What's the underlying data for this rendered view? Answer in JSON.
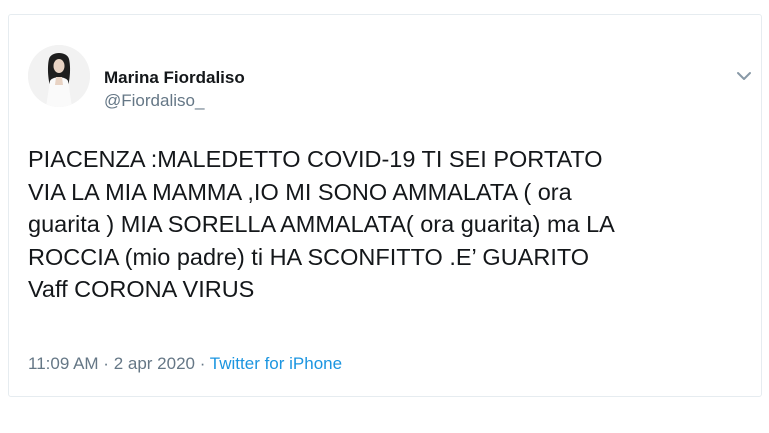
{
  "tweet": {
    "author_name": "Marina Fiordaliso",
    "author_handle": "@Fiordaliso_",
    "avatar_icon": "profile-photo",
    "menu_icon": "chevron-down-icon",
    "text_lines": [
      "PIACENZA :MALEDETTO COVID-19 TI SEI PORTATO",
      "VIA LA MIA MAMMA ,IO MI SONO AMMALATA ( ora",
      "guarita ) MIA SORELLA AMMALATA( ora guarita) ma LA",
      "ROCCIA (mio padre) ti HA SCONFITTO .E’ GUARITO",
      "Vaff CORONA VIRUS"
    ],
    "time": "11:09 AM",
    "separator": " · ",
    "date": "2 apr 2020",
    "source": "Twitter for iPhone"
  },
  "colors": {
    "text_primary": "#14171a",
    "text_secondary": "#657786",
    "link": "#1b95e0",
    "border": "#e6ecf0"
  }
}
